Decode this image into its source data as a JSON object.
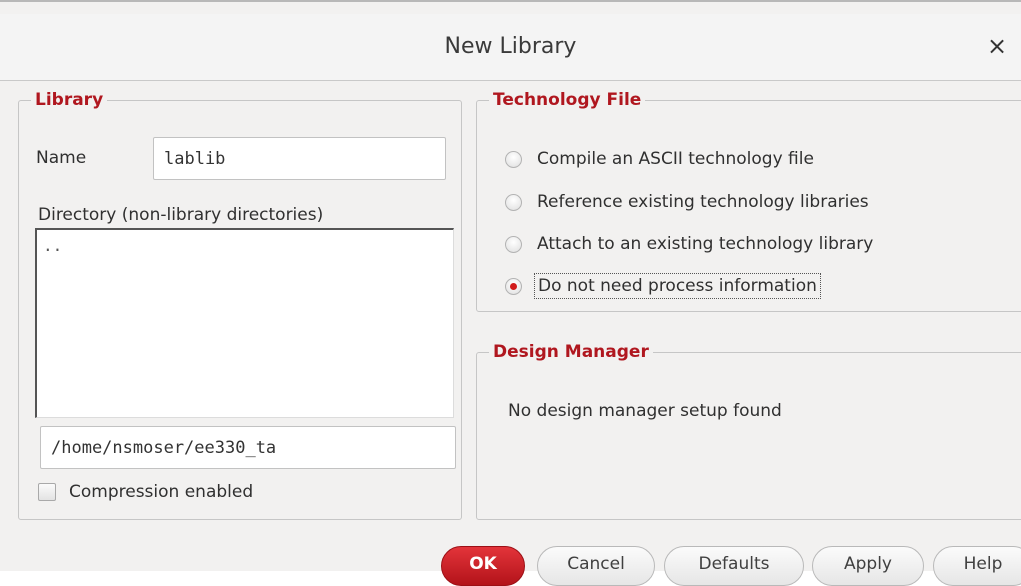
{
  "dialog": {
    "title": "New Library",
    "close_glyph": "×",
    "close_icon": "close-icon"
  },
  "library": {
    "legend": "Library",
    "name_label": "Name",
    "name_value": "lablib",
    "directory_label": "Directory (non-library directories)",
    "directory_items": [
      ".."
    ],
    "path_value": "/home/nsmoser/ee330_ta",
    "compression_label": "Compression enabled",
    "compression_checked": false
  },
  "technology_file": {
    "legend": "Technology File",
    "options": [
      {
        "label": "Compile an ASCII technology file",
        "selected": false
      },
      {
        "label": "Reference existing technology libraries",
        "selected": false
      },
      {
        "label": "Attach to an existing technology library",
        "selected": false
      },
      {
        "label": "Do not need process information",
        "selected": true
      }
    ]
  },
  "design_manager": {
    "legend": "Design Manager",
    "message": "No design manager setup found"
  },
  "buttons": {
    "ok": "OK",
    "cancel": "Cancel",
    "defaults": "Defaults",
    "apply": "Apply",
    "help": "Help"
  },
  "colors": {
    "accent_red": "#b0171f",
    "ok_button": "#c81e25"
  }
}
